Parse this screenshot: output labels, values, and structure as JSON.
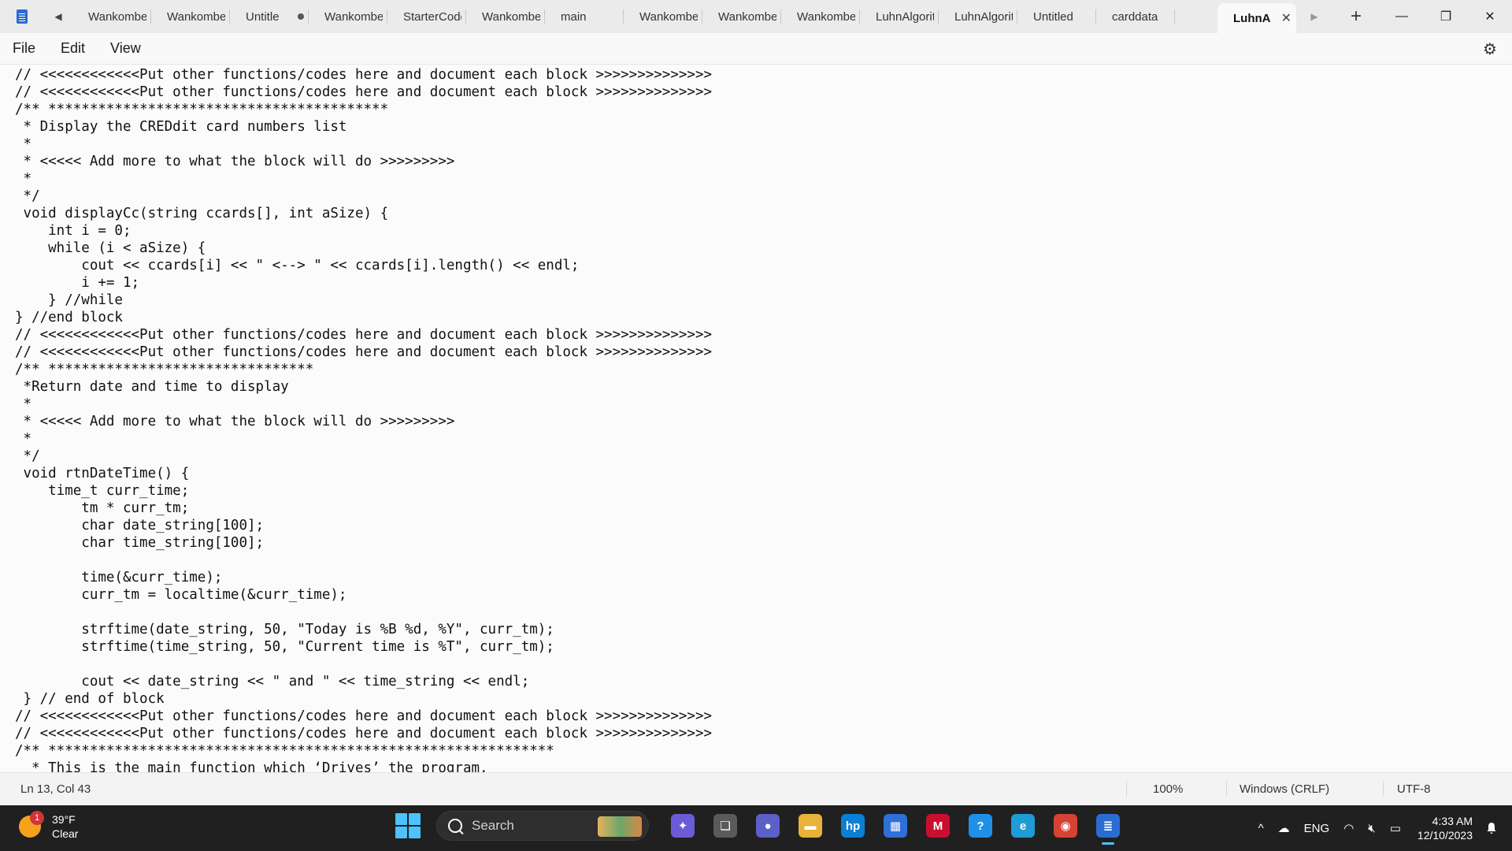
{
  "app": {
    "icon": "notepad-icon"
  },
  "tabs": [
    {
      "label": "WankombeF",
      "modified": false
    },
    {
      "label": "WankombeF",
      "modified": false
    },
    {
      "label": "Untitle",
      "modified": true
    },
    {
      "label": "WankombeF",
      "modified": false
    },
    {
      "label": "StarterCodes",
      "modified": false
    },
    {
      "label": "WankombeF",
      "modified": false
    },
    {
      "label": "main",
      "modified": false
    },
    {
      "label": "WankombeF",
      "modified": false
    },
    {
      "label": "WankombeF",
      "modified": false
    },
    {
      "label": "WankombeF",
      "modified": false
    },
    {
      "label": "LuhnAlgorith",
      "modified": false
    },
    {
      "label": "LuhnAlgorith",
      "modified": false
    },
    {
      "label": "Untitled",
      "modified": false
    },
    {
      "label": "carddata",
      "modified": false
    }
  ],
  "active_tab": {
    "label": "LuhnA",
    "close": "✕"
  },
  "toolbar": {
    "scroll_left": "◀",
    "scroll_right": "▶",
    "new_tab": "+"
  },
  "window": {
    "minimize": "—",
    "maximize": "❐",
    "close": "✕"
  },
  "menu": {
    "file": "File",
    "edit": "Edit",
    "view": "View",
    "settings": "⚙"
  },
  "editor": {
    "lines": [
      "// <<<<<<<<<<<<Put other functions/codes here and document each block >>>>>>>>>>>>>>",
      "// <<<<<<<<<<<<Put other functions/codes here and document each block >>>>>>>>>>>>>>",
      "/** *****************************************",
      " * Display the CREDdit card numbers list",
      " *",
      " * <<<<< Add more to what the block will do >>>>>>>>>",
      " *",
      " */",
      " void displayCc(string ccards[], int aSize) {",
      "    int i = 0;",
      "    while (i < aSize) {",
      "        cout << ccards[i] << \" <--> \" << ccards[i].length() << endl;",
      "        i += 1;",
      "    } //while",
      "} //end block",
      "// <<<<<<<<<<<<Put other functions/codes here and document each block >>>>>>>>>>>>>>",
      "// <<<<<<<<<<<<Put other functions/codes here and document each block >>>>>>>>>>>>>>",
      "/** ********************************",
      " *Return date and time to display",
      " *",
      " * <<<<< Add more to what the block will do >>>>>>>>>",
      " *",
      " */",
      " void rtnDateTime() {",
      "    time_t curr_time;",
      "        tm * curr_tm;",
      "        char date_string[100];",
      "        char time_string[100];",
      "",
      "        time(&curr_time);",
      "        curr_tm = localtime(&curr_time);",
      "",
      "        strftime(date_string, 50, \"Today is %B %d, %Y\", curr_tm);",
      "        strftime(time_string, 50, \"Current time is %T\", curr_tm);",
      "",
      "        cout << date_string << \" and \" << time_string << endl;",
      " } // end of block",
      "// <<<<<<<<<<<<Put other functions/codes here and document each block >>>>>>>>>>>>>>",
      "// <<<<<<<<<<<<Put other functions/codes here and document each block >>>>>>>>>>>>>>",
      "/** *************************************************************",
      "  * This is the main function which ‘Drives’ the program."
    ]
  },
  "status": {
    "position": "Ln 13, Col 43",
    "zoom": "100%",
    "line_ending": "Windows (CRLF)",
    "encoding": "UTF-8"
  },
  "taskbar": {
    "weather": {
      "temp": "39°F",
      "condition": "Clear",
      "badge": "1"
    },
    "search_placeholder": "Search",
    "apps": [
      {
        "name": "copilot-icon",
        "color": "#6b5bd6",
        "glyph": "✦"
      },
      {
        "name": "task-view-icon",
        "color": "#5a5a5a",
        "glyph": "❏"
      },
      {
        "name": "teams-chat-icon",
        "color": "#5b5fc7",
        "glyph": "●"
      },
      {
        "name": "file-explorer-icon",
        "color": "#e8b339",
        "glyph": "▬"
      },
      {
        "name": "myhp-icon",
        "color": "#0b7fd4",
        "glyph": "hp"
      },
      {
        "name": "microsoft-store-icon",
        "color": "#2f6fd8",
        "glyph": "▦"
      },
      {
        "name": "mcafee-icon",
        "color": "#c8102e",
        "glyph": "M"
      },
      {
        "name": "help-icon",
        "color": "#1e90e8",
        "glyph": "?"
      },
      {
        "name": "edge-icon",
        "color": "#1f9cd6",
        "glyph": "e"
      },
      {
        "name": "chrome-icon",
        "color": "#d64335",
        "glyph": "◉"
      },
      {
        "name": "notepad-taskbar-icon",
        "color": "#2b6cd1",
        "glyph": "≣"
      }
    ],
    "tray": {
      "chevron": "^",
      "language": "ENG",
      "time": "4:33 AM",
      "date": "12/10/2023"
    }
  }
}
